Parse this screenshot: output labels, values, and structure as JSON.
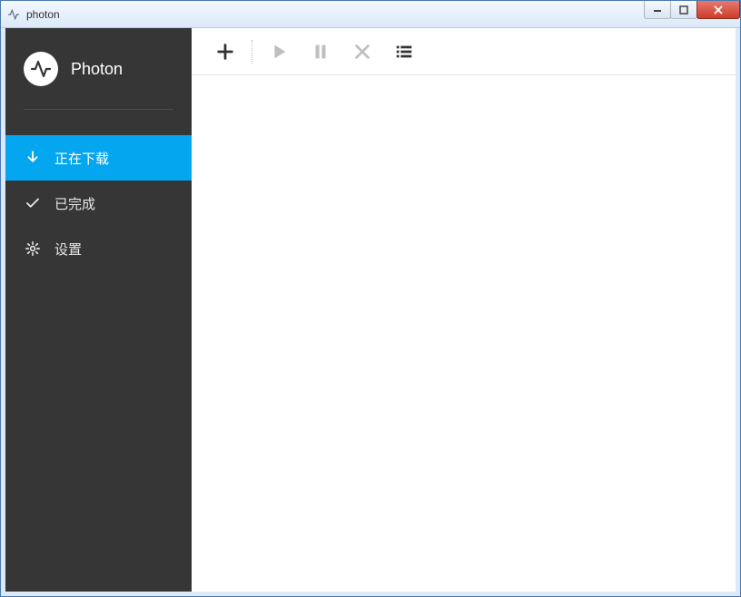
{
  "window": {
    "title": "photon"
  },
  "brand": {
    "name": "Photon"
  },
  "sidebar": {
    "items": [
      {
        "label": "正在下载",
        "icon": "download-icon",
        "active": true
      },
      {
        "label": "已完成",
        "icon": "check-icon",
        "active": false
      },
      {
        "label": "设置",
        "icon": "gear-icon",
        "active": false
      }
    ]
  },
  "toolbar": {
    "add": "add",
    "play": "play",
    "pause": "pause",
    "cancel": "cancel",
    "list": "list"
  },
  "colors": {
    "accent": "#05a6f0",
    "sidebar": "#363636"
  }
}
